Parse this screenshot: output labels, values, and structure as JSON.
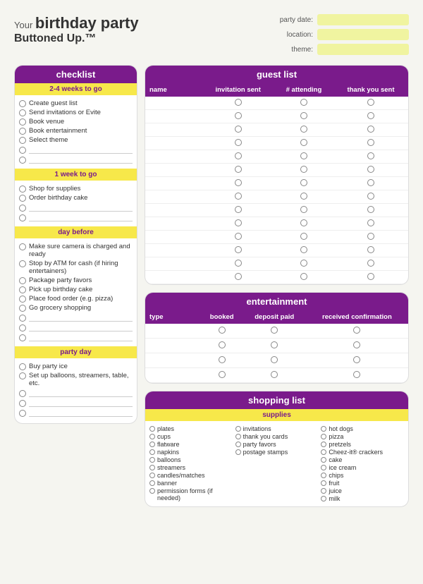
{
  "header": {
    "title_your": "Your",
    "title_main": "birthday party",
    "subtitle": "Buttoned Up.™",
    "fields": [
      {
        "label": "party date:",
        "value": ""
      },
      {
        "label": "location:",
        "value": ""
      },
      {
        "label": "theme:",
        "value": ""
      }
    ]
  },
  "checklist": {
    "title": "checklist",
    "sections": [
      {
        "heading": "2-4 weeks to go",
        "items": [
          "Create guest list",
          "Send invitations or Evite",
          "Book venue",
          "Book entertainment",
          "Select theme"
        ],
        "blanks": 2
      },
      {
        "heading": "1 week to go",
        "items": [
          "Shop for supplies",
          "Order birthday cake"
        ],
        "blanks": 2
      },
      {
        "heading": "day before",
        "items": [
          "Make sure camera is charged and ready",
          "Stop by ATM for cash (if hiring entertainers)",
          "Package party favors",
          "Pick up birthday cake",
          "Place food order (e.g. pizza)",
          "Go grocery shopping"
        ],
        "blanks": 3
      },
      {
        "heading": "party day",
        "items": [
          "Buy party ice",
          "Set up balloons, streamers, table, etc."
        ],
        "blanks": 3
      }
    ]
  },
  "guest_list": {
    "title": "guest list",
    "columns": [
      "name",
      "invitation sent",
      "# attending",
      "thank you sent"
    ],
    "rows": 14
  },
  "entertainment": {
    "title": "entertainment",
    "columns": [
      "type",
      "booked",
      "deposit paid",
      "received confirmation"
    ],
    "rows": 4
  },
  "shopping_list": {
    "title": "shopping list",
    "supplies_label": "supplies",
    "col1": [
      "plates",
      "cups",
      "flatware",
      "napkins",
      "balloons",
      "streamers",
      "candles/matches",
      "banner",
      "permission forms (if needed)"
    ],
    "col2": [
      "invitations",
      "thank you cards",
      "party favors",
      "postage stamps"
    ],
    "col3": [
      "hot dogs",
      "pizza",
      "pretzels",
      "Cheez-it® crackers",
      "cake",
      "ice cream",
      "chips",
      "fruit",
      "juice",
      "milk"
    ]
  }
}
